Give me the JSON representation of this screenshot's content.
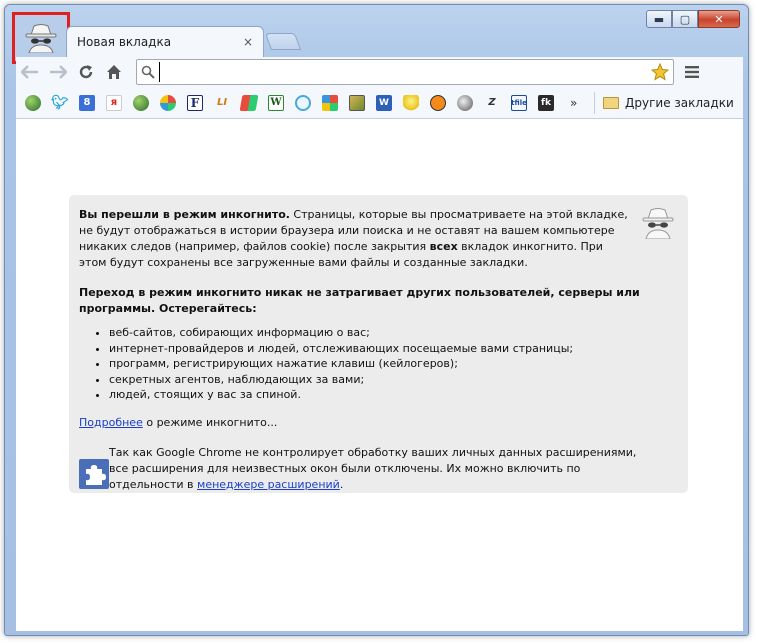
{
  "window": {
    "controls": [
      "▬",
      "▢",
      "✕"
    ]
  },
  "tab": {
    "title": "Новая вкладка",
    "close_glyph": "×"
  },
  "toolbar": {
    "omnibox_value": ""
  },
  "bookmarks": {
    "items": [
      {
        "icon": "globe-icon",
        "glyph": ""
      },
      {
        "icon": "twitter-icon",
        "glyph": ""
      },
      {
        "icon": "google-icon",
        "glyph": "8"
      },
      {
        "icon": "yandex-icon",
        "glyph": "я"
      },
      {
        "icon": "globe-icon",
        "glyph": ""
      },
      {
        "icon": "windows-icon",
        "glyph": ""
      },
      {
        "icon": "f-icon",
        "glyph": "F"
      },
      {
        "icon": "li-icon",
        "glyph": "LI"
      },
      {
        "icon": "windows-flag-icon",
        "glyph": ""
      },
      {
        "icon": "wikipedia-icon",
        "glyph": "W"
      },
      {
        "icon": "clock-icon",
        "glyph": ""
      },
      {
        "icon": "squares-icon",
        "glyph": ""
      },
      {
        "icon": "picture-icon",
        "glyph": ""
      },
      {
        "icon": "word-icon",
        "glyph": "W"
      },
      {
        "icon": "bulb-icon",
        "glyph": ""
      },
      {
        "icon": "orange-face-icon",
        "glyph": ""
      },
      {
        "icon": "ball-icon",
        "glyph": ""
      },
      {
        "icon": "z-icon",
        "glyph": "Z"
      },
      {
        "icon": "tfile-icon",
        "glyph": "tfile"
      },
      {
        "icon": "fk-icon",
        "glyph": "fk"
      }
    ],
    "overflow_glyph": "»",
    "other_label": "Другие закладки"
  },
  "incognito": {
    "p1_bold": "Вы перешли в режим инкогнито.",
    "p1_a": " Страницы, которые вы просматриваете на этой вкладке, не будут отображаться в истории браузера или поиска и не оставят на вашем компьютере никаких следов (например, файлов cookie) после закрытия ",
    "p1_strong": "всех",
    "p1_b": " вкладок инкогнито. При этом будут сохранены все загруженные вами файлы и созданные закладки.",
    "p2": "Переход в режим инкогнито никак не затрагивает других пользователей, серверы или программы. Остерегайтесь:",
    "list": [
      "веб-сайтов, собирающих информацию о вас;",
      "интернет-провайдеров и людей, отслеживающих посещаемые вами страницы;",
      "программ, регистрирующих нажатие клавиш (кейлогеров);",
      "секретных агентов, наблюдающих за вами;",
      "людей, стоящих у вас за спиной."
    ],
    "more_link": "Подробнее",
    "more_rest": " о режиме инкогнито...",
    "ext_text": "Так как Google Chrome не контролирует обработку ваших личных данных расширениями, все расширения для неизвестных окон были отключены. Их можно включить по отдельности в ",
    "ext_link": "менеджере расширений",
    "ext_end": "."
  },
  "colors": {
    "accent_link": "#1a3fc8",
    "highlight_border": "#e02020",
    "panel_bg": "#ececec"
  }
}
